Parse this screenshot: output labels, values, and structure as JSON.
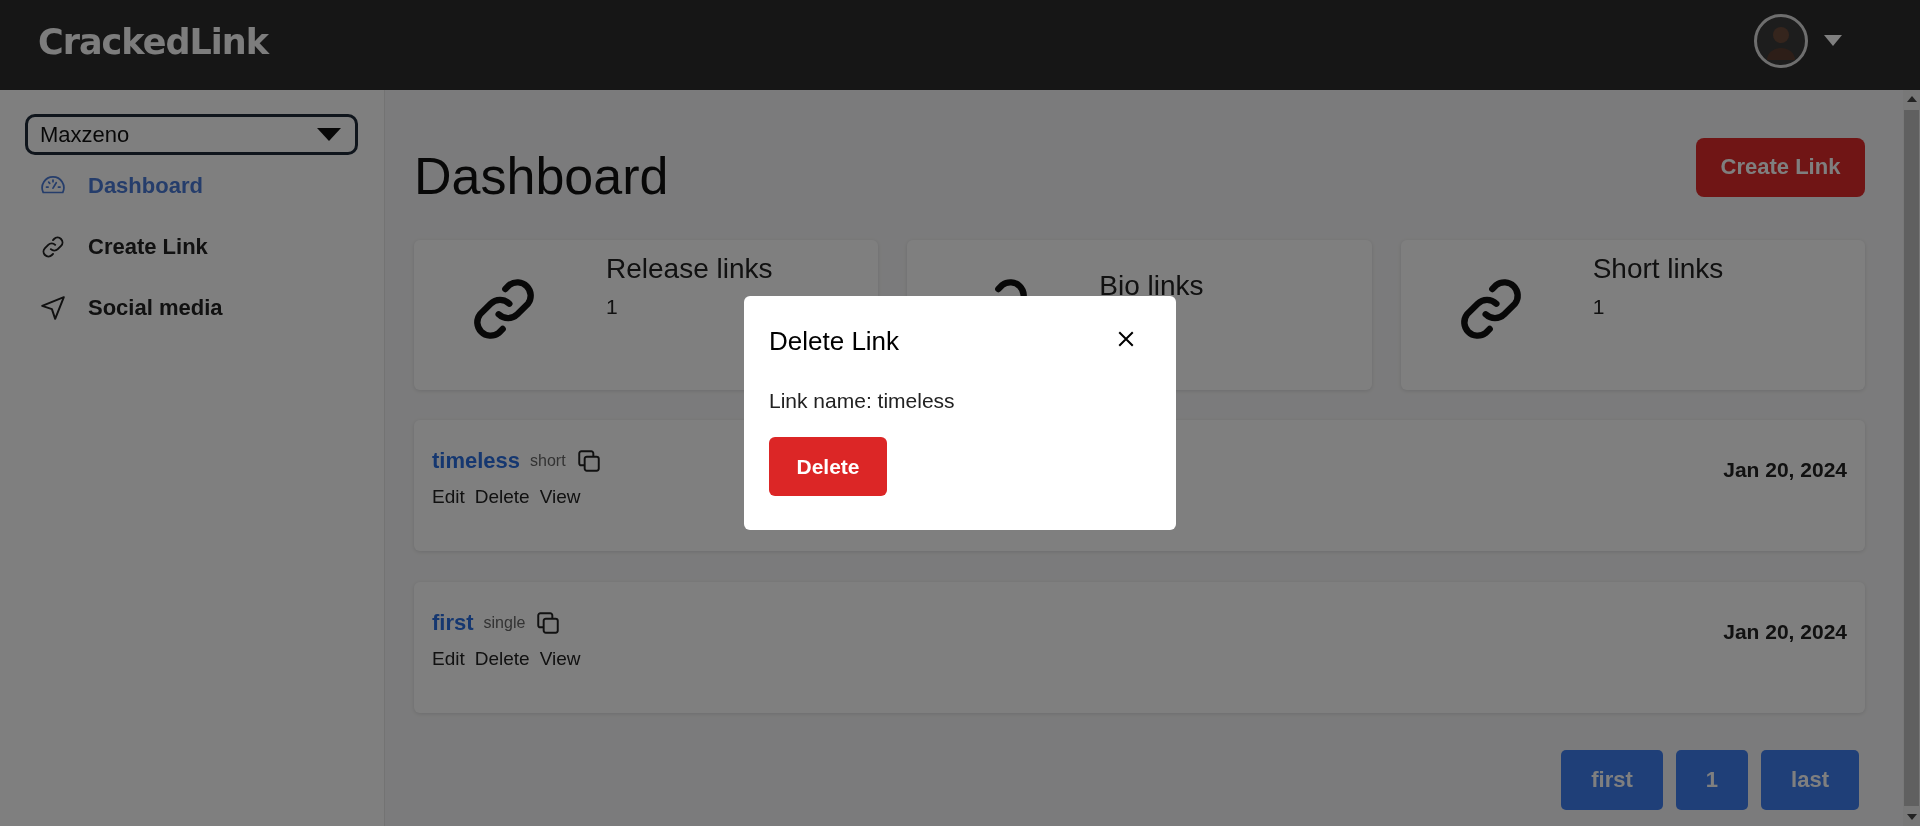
{
  "header": {
    "logo": "CrackedLink"
  },
  "sidebar": {
    "account_select": {
      "value": "Maxzeno"
    },
    "items": [
      {
        "label": "Dashboard",
        "kind": "gauge",
        "selected": true
      },
      {
        "label": "Create Link",
        "kind": "link",
        "selected": false
      },
      {
        "label": "Social media",
        "kind": "send",
        "selected": false
      }
    ]
  },
  "page": {
    "title": "Dashboard",
    "create_button": "Create Link"
  },
  "stats": [
    {
      "label": "Release links",
      "count": "1"
    },
    {
      "label": "Bio links"
    },
    {
      "label": "Short links",
      "count": "1"
    }
  ],
  "links": [
    {
      "name": "timeless",
      "type": "short",
      "actions": [
        "Edit",
        "Delete",
        "View"
      ],
      "date": "Jan 20, 2024"
    },
    {
      "name": "first",
      "type": "single",
      "actions": [
        "Edit",
        "Delete",
        "View"
      ],
      "date": "Jan 20, 2024"
    }
  ],
  "pagination": [
    "first",
    "1",
    "last"
  ],
  "modal": {
    "title": "Delete Link",
    "body": "Link name: timeless",
    "confirm_button": "Delete"
  }
}
